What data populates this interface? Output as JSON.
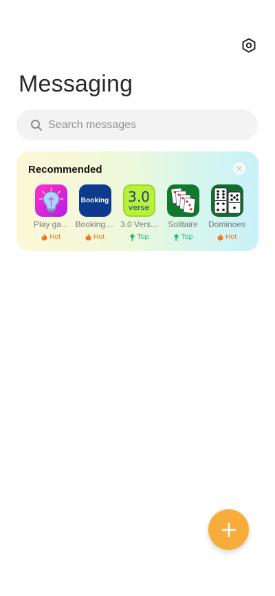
{
  "header": {
    "title": "Messaging",
    "settings_icon": "settings-hexagon-icon"
  },
  "search": {
    "placeholder": "Search messages",
    "icon": "search-icon"
  },
  "recommended": {
    "title": "Recommended",
    "close_icon": "close-icon",
    "apps": [
      {
        "name": "Play ga...",
        "badge": "Hot",
        "badge_type": "hot",
        "icon": "lightbulb-app-icon"
      },
      {
        "name": "Booking....",
        "badge": "Hot",
        "badge_type": "hot",
        "icon": "booking-app-icon",
        "icon_text": "Booking"
      },
      {
        "name": "3.0 Vers...",
        "badge": "Top",
        "badge_type": "top",
        "icon": "verse-app-icon",
        "icon_text_main": "3.0",
        "icon_text_sub": "verse"
      },
      {
        "name": "Solitaire",
        "badge": "Top",
        "badge_type": "top",
        "icon": "solitaire-app-icon"
      },
      {
        "name": "Dominoes",
        "badge": "Hot",
        "badge_type": "hot",
        "icon": "dominoes-app-icon"
      }
    ]
  },
  "fab": {
    "icon": "plus-icon"
  },
  "colors": {
    "accent": "#f7ac3b",
    "hot": "#f07a1a",
    "top": "#1fb87a"
  }
}
